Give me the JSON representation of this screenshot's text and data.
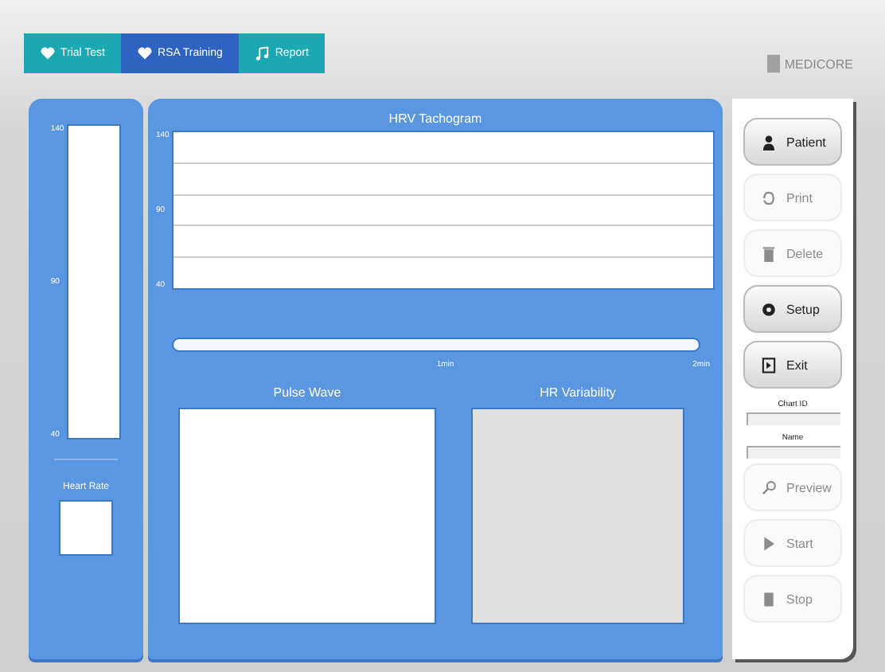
{
  "tabs": [
    {
      "label": "Trial Test",
      "kind": "heart",
      "selected": false
    },
    {
      "label": "RSA Training",
      "kind": "heart",
      "selected": true
    },
    {
      "label": "Report",
      "kind": "note",
      "selected": false
    }
  ],
  "logo": {
    "text": "MEDICORE"
  },
  "heart_rate_panel": {
    "ticks": [
      "140",
      "90",
      "40"
    ],
    "label": "Heart Rate"
  },
  "tachogram": {
    "title": "HRV Tachogram",
    "ticks": [
      "140",
      "90",
      "40"
    ],
    "time_labels": [
      "1min",
      "2min"
    ]
  },
  "pulse_wave": {
    "title": "Pulse Wave"
  },
  "hr_variability": {
    "title": "HR Variability"
  },
  "buttons": [
    {
      "label": "Patient",
      "kind": "person",
      "disabled": false
    },
    {
      "label": "Print",
      "kind": "print",
      "disabled": true
    },
    {
      "label": "Delete",
      "kind": "trash",
      "disabled": true
    },
    {
      "label": "Setup",
      "kind": "gear",
      "disabled": false
    },
    {
      "label": "Exit",
      "kind": "exit",
      "disabled": false
    }
  ],
  "fields": [
    {
      "label": "Chart ID"
    },
    {
      "label": "Name"
    }
  ],
  "actions": [
    {
      "label": "Preview",
      "kind": "search",
      "disabled": true
    },
    {
      "label": "Start",
      "kind": "play",
      "disabled": true
    },
    {
      "label": "Stop",
      "kind": "stop",
      "disabled": true
    }
  ]
}
